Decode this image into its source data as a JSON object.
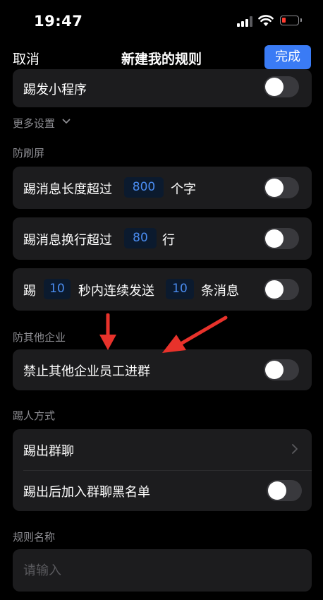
{
  "status": {
    "time": "19:47"
  },
  "nav": {
    "cancel": "取消",
    "title": "新建我的规则",
    "done": "完成"
  },
  "top_row": {
    "label": "踢发小程序"
  },
  "more_settings": {
    "label": "更多设置"
  },
  "anti_spam": {
    "section": "防刷屏",
    "msg_length": {
      "prefix": "踢消息长度超过",
      "value": "800",
      "suffix": "个字"
    },
    "msg_lines": {
      "prefix": "踢消息换行超过",
      "value": "80",
      "suffix": "行"
    },
    "rapid": {
      "prefix": "踢",
      "seconds": "10",
      "middle": "秒内连续发送",
      "count": "10",
      "suffix": "条消息"
    }
  },
  "other_company": {
    "section": "防其他企业",
    "label": "禁止其他企业员工进群"
  },
  "kick_method": {
    "section": "踢人方式",
    "kick_out": "踢出群聊",
    "blacklist": "踢出后加入群聊黑名单"
  },
  "rule_name": {
    "section": "规则名称",
    "placeholder": "请输入"
  },
  "colors": {
    "accent": "#3a7bf5",
    "annotation_arrow": "#e8322b"
  }
}
